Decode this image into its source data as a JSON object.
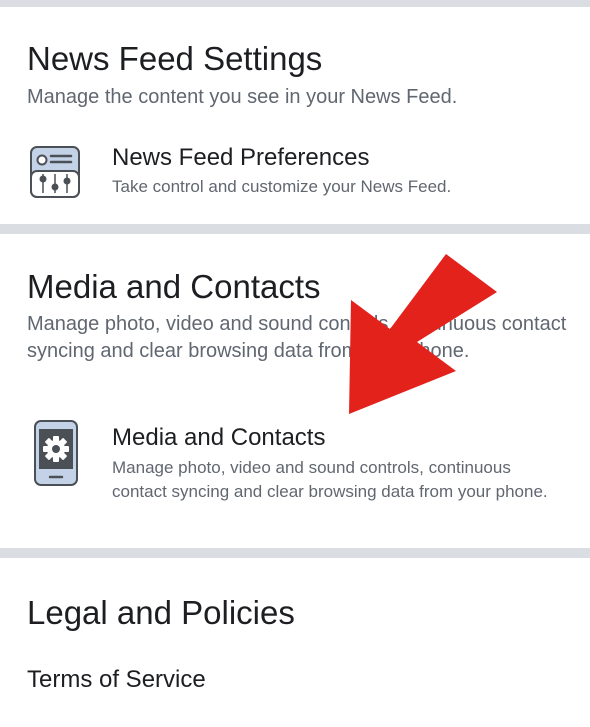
{
  "news_feed_section": {
    "title": "News Feed Settings",
    "description": "Manage the content you see in your News Feed.",
    "item": {
      "icon": "news-feed-preferences-icon",
      "title": "News Feed Preferences",
      "description": "Take control and customize your News Feed."
    }
  },
  "media_section": {
    "title": "Media and Contacts",
    "description": "Manage photo, video and sound controls, continuous contact syncing and clear browsing data from your phone.",
    "item": {
      "icon": "phone-gear-icon",
      "title": "Media and Contacts",
      "description": "Manage photo, video and sound controls, continuous contact syncing and clear browsing data from your phone."
    }
  },
  "legal_section": {
    "title": "Legal and Policies",
    "item": {
      "title": "Terms of Service"
    }
  },
  "colors": {
    "divider": "#dadde1",
    "arrow": "#e3221c",
    "icon_body": "#4b4f56",
    "icon_screen": "#c4d2e7"
  }
}
